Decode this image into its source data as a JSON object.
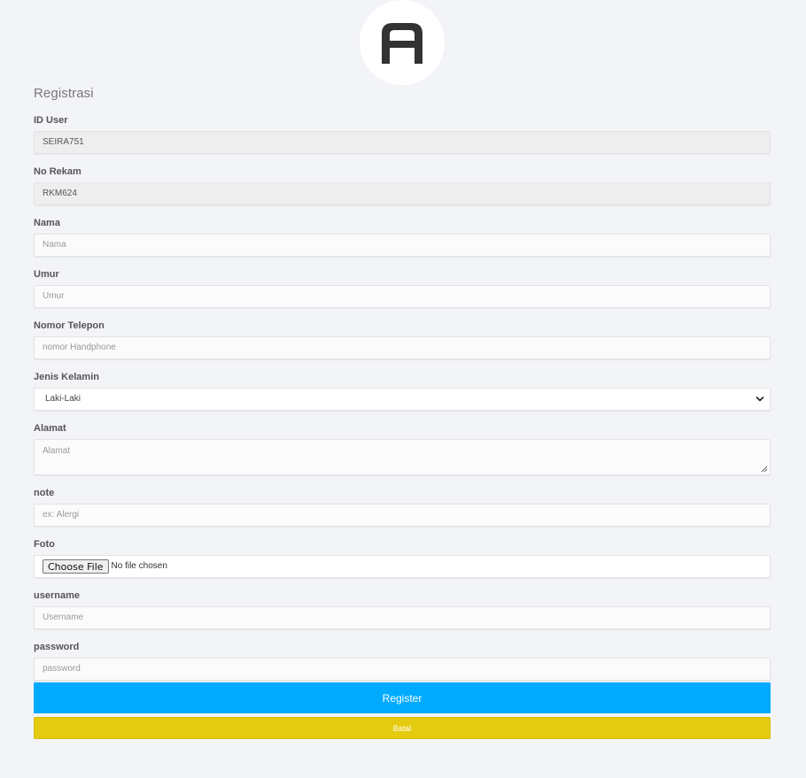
{
  "logo": {
    "letter": "A"
  },
  "form": {
    "title": "Registrasi",
    "fields": {
      "id_user": {
        "label": "ID User",
        "value": "SEIRA751"
      },
      "no_rekam": {
        "label": "No Rekam",
        "value": "RKM624"
      },
      "nama": {
        "label": "Nama",
        "placeholder": "Nama"
      },
      "umur": {
        "label": "Umur",
        "placeholder": "Umur"
      },
      "telepon": {
        "label": "Nomor Telepon",
        "placeholder": "nomor Handphone"
      },
      "jenis_kelamin": {
        "label": "Jenis Kelamin",
        "selected": "Laki-Laki"
      },
      "alamat": {
        "label": "Alamat",
        "placeholder": "Alamat"
      },
      "note": {
        "label": "note",
        "placeholder": "ex: Alergi"
      },
      "foto": {
        "label": "Foto",
        "button": "Choose File",
        "status": "No file chosen"
      },
      "username": {
        "label": "username",
        "placeholder": "Username"
      },
      "password": {
        "label": "password",
        "placeholder": "password"
      }
    },
    "buttons": {
      "register": "Register",
      "batal": "Batal"
    }
  },
  "colors": {
    "background": "#f3f4f8",
    "register": "#00aaff",
    "batal": "#e5cb0f",
    "logo_fg": "#333333"
  },
  "icons": {
    "select": "chevron-down-icon",
    "textarea": "resize-grip-icon",
    "logo": "logo-a-icon"
  }
}
